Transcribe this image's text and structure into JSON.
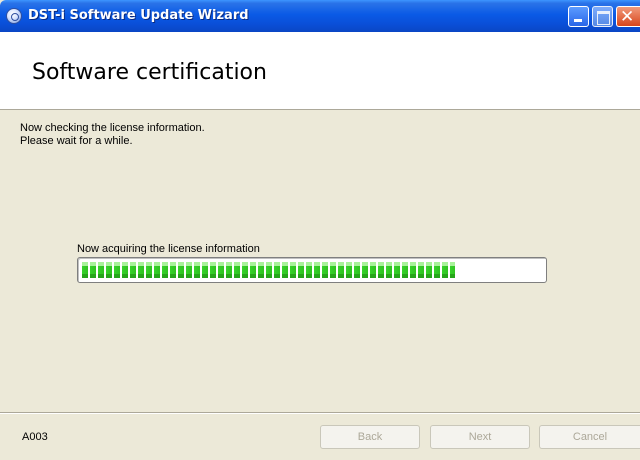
{
  "window": {
    "title": "DST-i Software Update Wizard",
    "app_icon": "dst-app-icon",
    "controls": {
      "minimize": "minimize-icon",
      "maximize": "maximize-icon",
      "close": "close-icon",
      "close_glyph": "✕"
    }
  },
  "header": {
    "title": "Software certification"
  },
  "body": {
    "message_lines": [
      "Now checking the license information.",
      "Please wait for a while."
    ],
    "progress_label": "Now acquiring the license information",
    "progress_fraction": 0.81
  },
  "footer": {
    "code": "A003",
    "buttons": {
      "back": "Back",
      "next": "Next",
      "cancel": "Cancel"
    }
  },
  "colors": {
    "titlebar": "#0a5ae6",
    "progress_green": "#36d32a",
    "background": "#ece9d8"
  }
}
